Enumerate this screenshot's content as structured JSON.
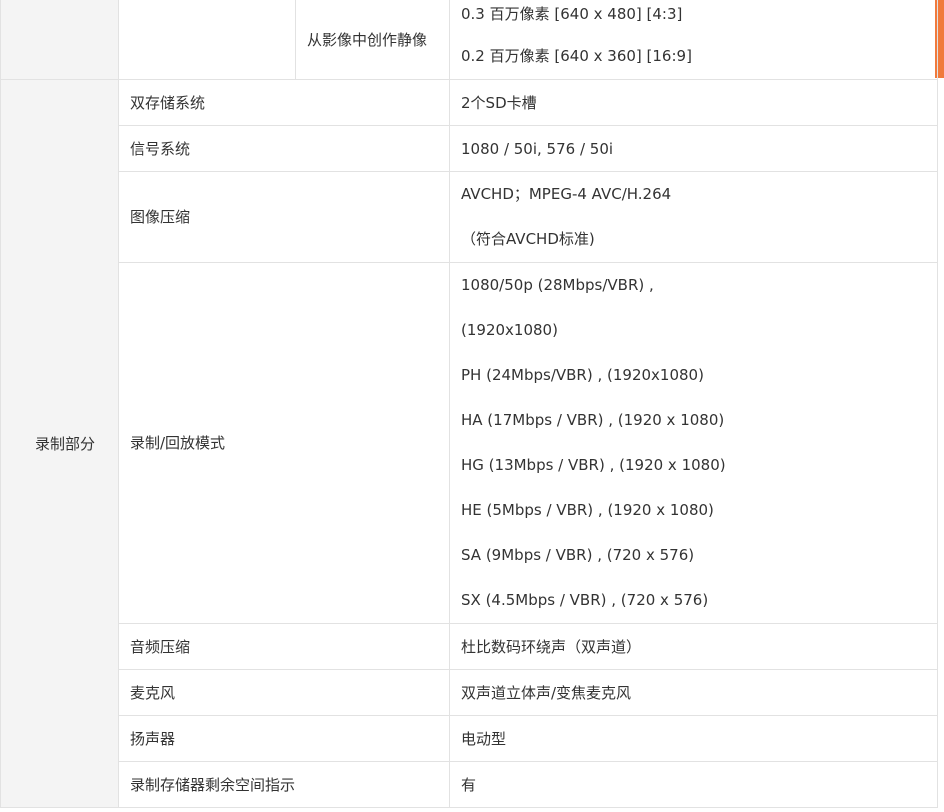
{
  "top_section": {
    "sub_label": "从影像中创作静像",
    "values": [
      "0.3 百万像素 [640 x 480] [4:3]",
      "0.2 百万像素 [640 x 360] [16:9]"
    ]
  },
  "recording": {
    "group_label": "录制部分",
    "rows": [
      {
        "label": "双存储系统",
        "values": [
          "2个SD卡槽"
        ]
      },
      {
        "label": "信号系统",
        "values": [
          "1080 / 50i, 576 / 50i"
        ]
      },
      {
        "label": "图像压缩",
        "values": [
          "AVCHD；MPEG-4 AVC/H.264",
          "（符合AVCHD标准)"
        ]
      },
      {
        "label": "录制/回放模式",
        "values": [
          "1080/50p (28Mbps/VBR) ,",
          "(1920x1080)",
          "PH (24Mbps/VBR) , (1920x1080)",
          "HA (17Mbps / VBR) , (1920 x 1080)",
          "HG (13Mbps / VBR) , (1920 x 1080)",
          "HE (5Mbps / VBR) , (1920 x 1080)",
          "SA (9Mbps / VBR) , (720 x 576)",
          "SX (4.5Mbps / VBR) , (720 x 576)"
        ]
      },
      {
        "label": "音频压缩",
        "values": [
          "杜比数码环绕声（双声道）"
        ]
      },
      {
        "label": "麦克风",
        "values": [
          "双声道立体声/变焦麦克风"
        ]
      },
      {
        "label": "扬声器",
        "values": [
          "电动型"
        ]
      },
      {
        "label": "录制存储器剩余空间指示",
        "values": [
          "有"
        ]
      }
    ]
  }
}
